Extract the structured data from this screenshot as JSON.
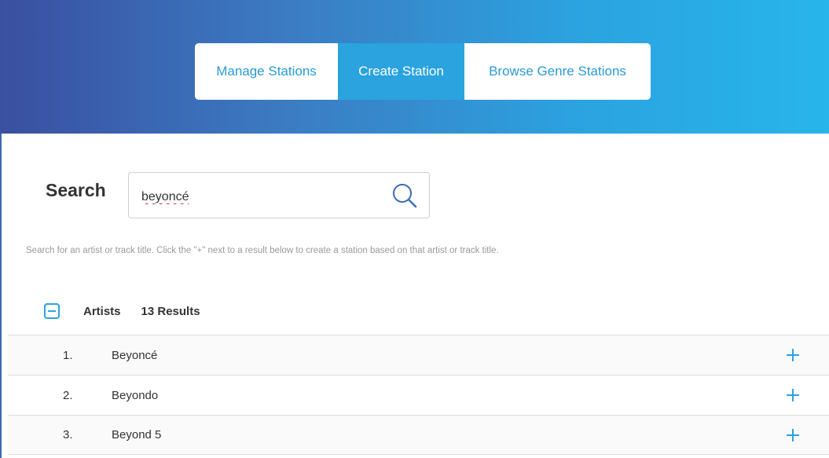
{
  "nav": {
    "tabs": [
      {
        "label": "Manage Stations",
        "active": false
      },
      {
        "label": "Create Station",
        "active": true
      },
      {
        "label": "Browse Genre Stations",
        "active": false
      }
    ]
  },
  "search": {
    "title": "Search",
    "value": "beyoncé",
    "icon": "search-icon",
    "hint": "Search for an artist or track title. Click the \"+\" next to a result below to create a station based on that artist or track title."
  },
  "artists": {
    "label": "Artists",
    "count": "13 Results",
    "collapse_icon": "minus-square-icon",
    "items": [
      {
        "num": "1.",
        "name": "Beyoncé"
      },
      {
        "num": "2.",
        "name": "Beyondo"
      },
      {
        "num": "3.",
        "name": "Beyond 5"
      }
    ]
  },
  "colors": {
    "accent": "#2aa3df",
    "header_start": "#3a4fa0",
    "header_end": "#27b5eb"
  }
}
